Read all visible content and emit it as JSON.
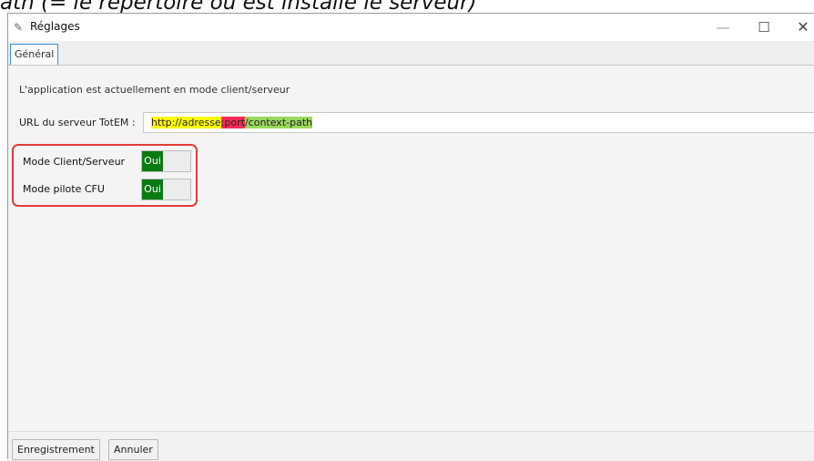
{
  "caption": "ath (= le répertoire où est installé le serveur)",
  "window": {
    "title": "Réglages",
    "app_icon": "settings-app-icon",
    "controls": [
      "minimize-icon",
      "maximize-icon",
      "close-icon"
    ]
  },
  "tabs": [
    {
      "label": "Général",
      "selected": true
    }
  ],
  "main": {
    "status_text": "L'application est actuellement en mode client/serveur",
    "url_label": "URL du serveur TotEM :",
    "url_value_parts": [
      "http://adresse",
      ":port",
      "/context-path"
    ],
    "toggles": [
      {
        "label": "Mode Client/Serveur",
        "state": "Oui"
      },
      {
        "label": "Mode pilote CFU",
        "state": "Oui"
      }
    ]
  },
  "footer": {
    "save_label": "Enregistrement",
    "cancel_label": "Annuler"
  },
  "colors": {
    "toggle_on": "#0a7a12",
    "tab_border": "#3c8ed6",
    "annotation_red": "#e23b3b",
    "highlight_yellow": "#ffff00",
    "highlight_pink": "#ff2a57",
    "highlight_green": "#99d95c"
  }
}
